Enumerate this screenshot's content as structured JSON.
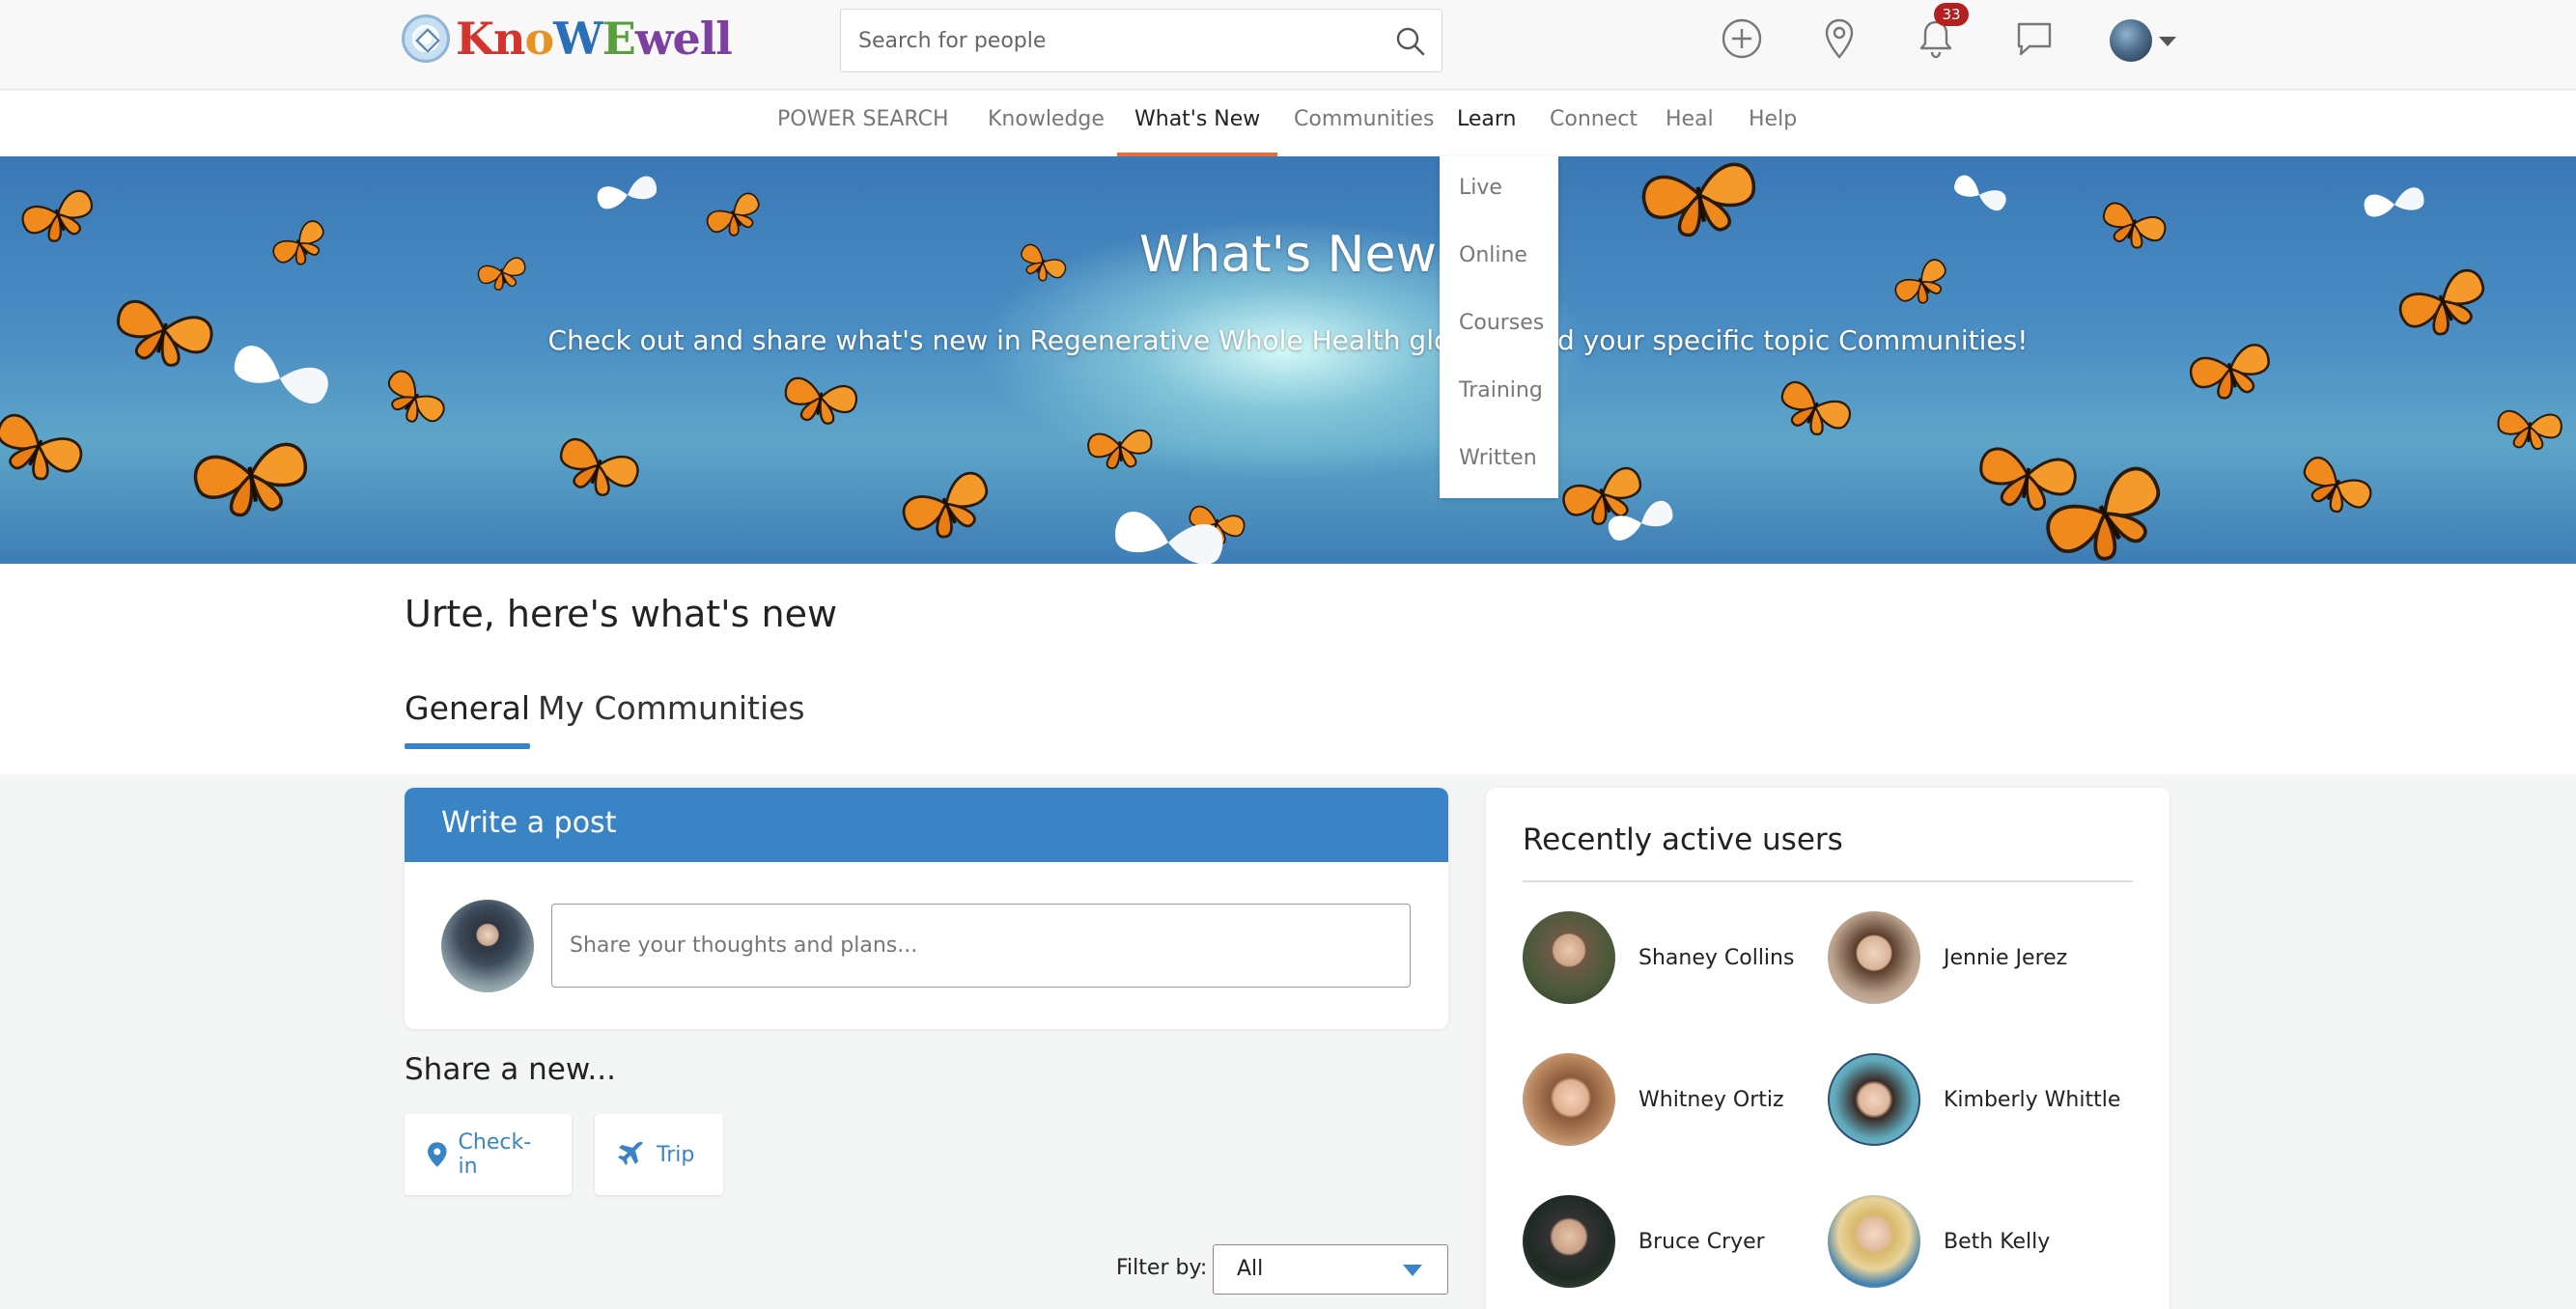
{
  "logo": {
    "text_parts": [
      "Kn",
      "o",
      "W",
      "E",
      "well"
    ]
  },
  "search": {
    "placeholder": "Search for people"
  },
  "header": {
    "notifications_count": "33"
  },
  "nav": {
    "items": [
      "POWER SEARCH",
      "Knowledge",
      "What's New",
      "Communities",
      "Learn",
      "Connect",
      "Heal",
      "Help"
    ],
    "active": "What's New",
    "open_menu": "Learn"
  },
  "learn_menu": {
    "items": [
      "Live",
      "Online",
      "Courses",
      "Training",
      "Written"
    ]
  },
  "hero": {
    "title": "What's New",
    "subtitle": "Check out and share what's new in Regenerative Whole Health globally and your specific topic Communities!"
  },
  "greeting": "Urte, here's what's new",
  "tabs": [
    {
      "label": "General",
      "active": true
    },
    {
      "label": "My Communities",
      "active": false
    }
  ],
  "post": {
    "title": "Write a post",
    "placeholder": "Share your thoughts and plans..."
  },
  "share": {
    "title": "Share a new...",
    "checkin_label": "Check-in",
    "trip_label": "Trip"
  },
  "filter": {
    "label": "Filter by:",
    "value": "All"
  },
  "recent_users": {
    "title": "Recently active users",
    "users": [
      {
        "name": "Shaney Collins"
      },
      {
        "name": "Jennie Jerez"
      },
      {
        "name": "Whitney Ortiz"
      },
      {
        "name": "Kimberly Whittle"
      },
      {
        "name": "Bruce Cryer"
      },
      {
        "name": "Beth Kelly"
      }
    ]
  },
  "colors": {
    "accent": "#3a84c6",
    "nav_underline": "#ea6b3a",
    "badge": "#b32020"
  }
}
